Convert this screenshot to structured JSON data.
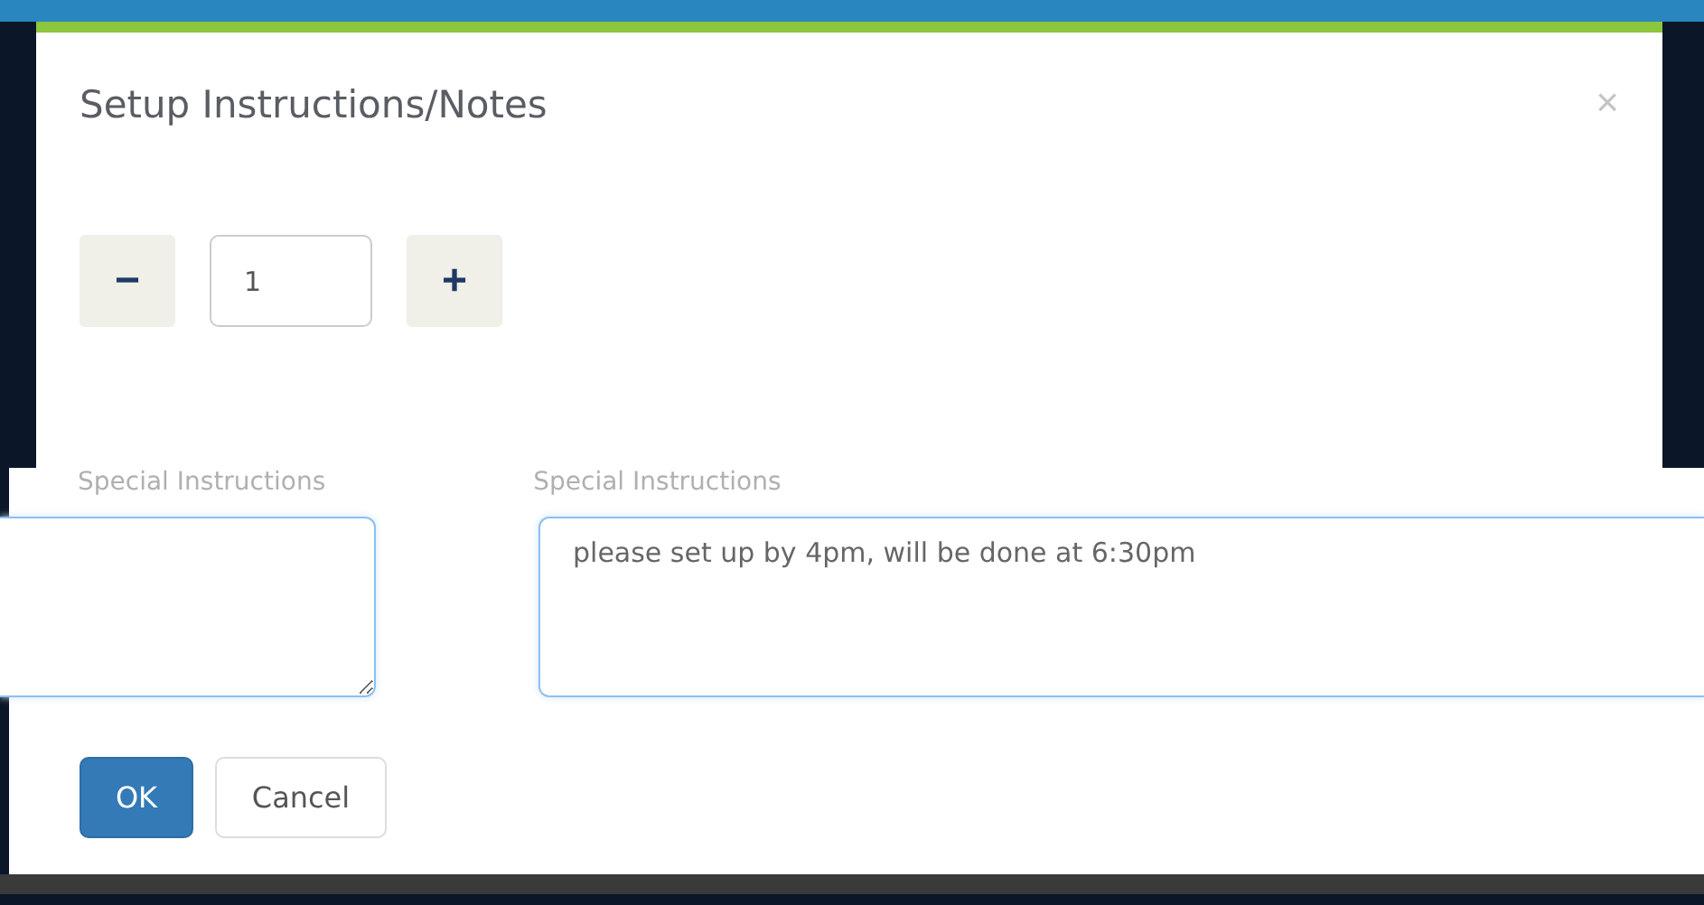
{
  "dialog": {
    "title": "Setup Instructions/Notes",
    "close": "×"
  },
  "quantity": {
    "decrement": "−",
    "value": "1",
    "increment": "+"
  },
  "fields": [
    {
      "label": "Special Instructions"
    },
    {
      "label": "Special Instructions",
      "value": "please set up by 4pm, will be done at 6:30pm"
    }
  ],
  "buttons": [
    {
      "label": "OK",
      "kind": "primary"
    },
    {
      "label": "Cancel",
      "kind": "default"
    }
  ]
}
